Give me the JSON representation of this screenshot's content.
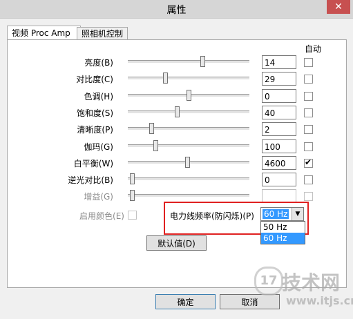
{
  "window": {
    "title": "属性",
    "close_glyph": "✕"
  },
  "tabs": [
    {
      "label": "视频 Proc Amp",
      "active": true
    },
    {
      "label": "照相机控制",
      "active": false
    }
  ],
  "auto_header": "自动",
  "rows": [
    {
      "label": "亮度(B)",
      "value": "14",
      "level": 0.62,
      "auto_checked": false,
      "disabled": false
    },
    {
      "label": "对比度(C)",
      "value": "29",
      "level": 0.3,
      "auto_checked": false,
      "disabled": false
    },
    {
      "label": "色调(H)",
      "value": "0",
      "level": 0.5,
      "auto_checked": false,
      "disabled": false
    },
    {
      "label": "饱和度(S)",
      "value": "40",
      "level": 0.4,
      "auto_checked": false,
      "disabled": false
    },
    {
      "label": "清晰度(P)",
      "value": "2",
      "level": 0.18,
      "auto_checked": false,
      "disabled": false
    },
    {
      "label": "伽玛(G)",
      "value": "100",
      "level": 0.22,
      "auto_checked": false,
      "disabled": false
    },
    {
      "label": "白平衡(W)",
      "value": "4600",
      "level": 0.49,
      "auto_checked": true,
      "disabled": false
    },
    {
      "label": "逆光对比(B)",
      "value": "0",
      "level": 0.02,
      "auto_checked": false,
      "disabled": false
    },
    {
      "label": "增益(G)",
      "value": "",
      "level": 0.02,
      "auto_checked": false,
      "disabled": true
    }
  ],
  "color_enable": {
    "label": "启用颜色(E)",
    "checked": false
  },
  "powerline": {
    "label": "电力线频率(防闪烁)(P)",
    "selected": "60 Hz",
    "options": [
      "50 Hz",
      "60 Hz"
    ]
  },
  "default_button": "默认值(D)",
  "ok_button": "确定",
  "cancel_button": "取消",
  "watermark": {
    "text": "技术网",
    "site": "www.itjs.cn",
    "badge": "17"
  },
  "colors": {
    "highlight": "#3399ff",
    "annotation": "#e02020",
    "close": "#c75050"
  }
}
